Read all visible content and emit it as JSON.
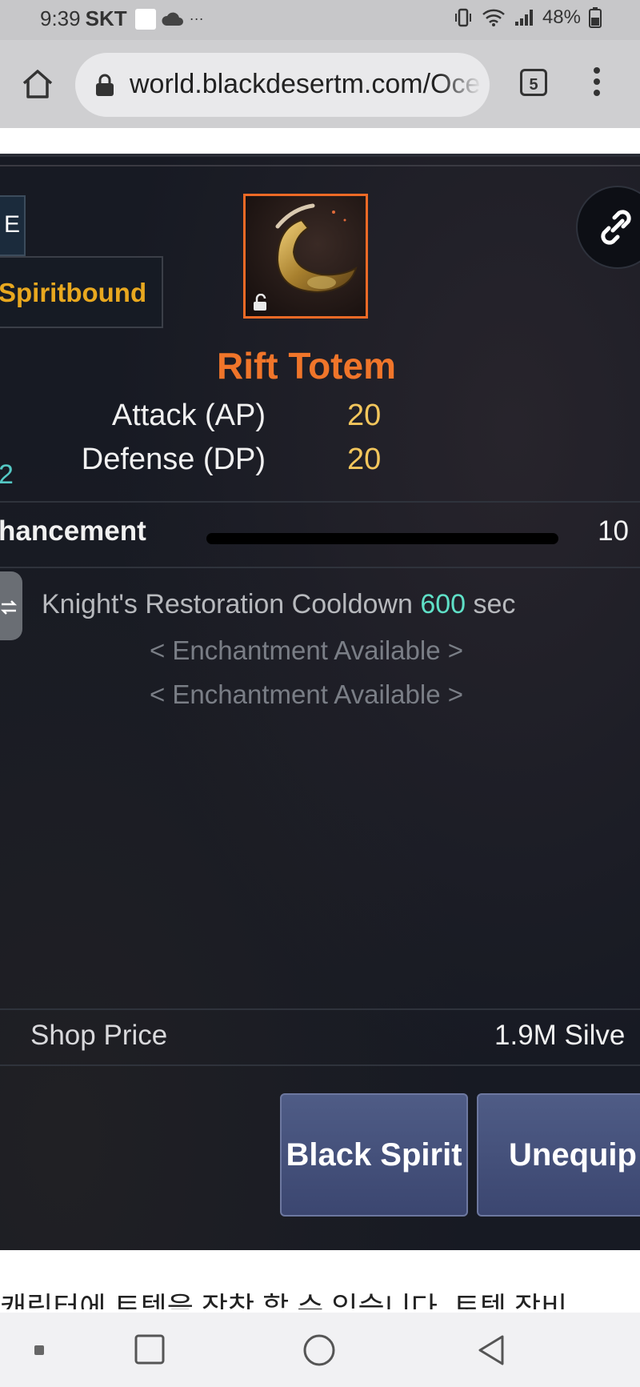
{
  "status_bar": {
    "time": "9:39",
    "carrier": "SKT",
    "extra": "···",
    "battery": "48%"
  },
  "browser": {
    "url": "world.blackdesertm.com/Oce",
    "tab_count": "5"
  },
  "item": {
    "grade_tab": "E",
    "bound_label": "Spiritbound",
    "name": "Rift Totem",
    "stats": [
      {
        "label": "Attack (AP)",
        "value": "20"
      },
      {
        "label": "Defense (DP)",
        "value": "20"
      }
    ],
    "side_value": "2",
    "enhancement_label": "hancement",
    "enhancement_value": "10",
    "effect_text": "Knight's Restoration Cooldown",
    "effect_value": "600",
    "effect_unit": "sec",
    "enchant_slots": [
      "< Enchantment Available >",
      "< Enchantment Available >"
    ],
    "shop_price_label": "Shop Price",
    "shop_price_value": "1.9M Silve",
    "buttons": {
      "black_spirit": "Black Spirit",
      "unequip": "Unequip"
    }
  },
  "page_text": "캐릭터에 토템을 장착 할 수 있습니다. 토템 장비"
}
